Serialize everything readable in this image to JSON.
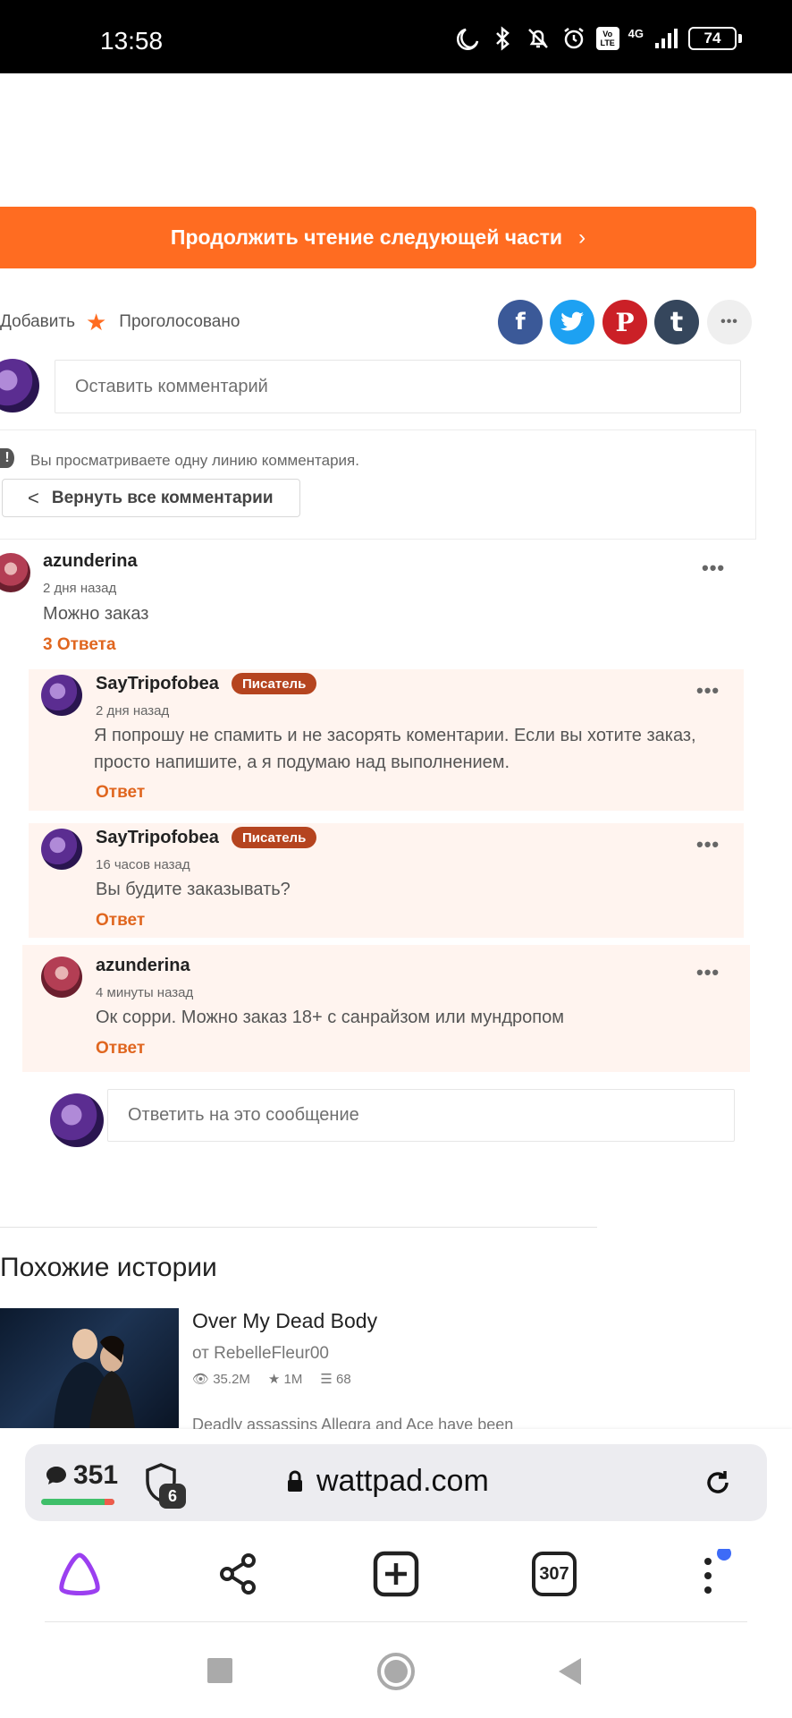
{
  "status_bar": {
    "time": "13:58",
    "network": "4G",
    "volte": "Vo LTE",
    "battery": "74"
  },
  "continue_button": {
    "label": "Продолжить чтение следующей части",
    "chevron": "›"
  },
  "vote": {
    "add_label": "Добавить",
    "voted_label": "Проголосовано"
  },
  "share": {
    "facebook": "f",
    "twitter": "twitter-icon",
    "pinterest": "P",
    "tumblr": "t",
    "more": "•••",
    "colors": {
      "facebook": "#3b5998",
      "twitter": "#1da1f2",
      "pinterest": "#cb2027",
      "tumblr": "#35465c",
      "more": "#efefef"
    }
  },
  "comment_input": {
    "placeholder": "Оставить комментарий"
  },
  "thread_notice": {
    "info": "!",
    "text": "Вы просматриваете одну линию комментария.",
    "back_label": "Вернуть все комментарии"
  },
  "main_comment": {
    "user": "azunderina",
    "time": "2 дня назад",
    "text": "Можно заказ",
    "replies_link": "3 Ответа",
    "more": "•••"
  },
  "replies": [
    {
      "user": "SayTripofobea",
      "badge": "Писатель",
      "time": "2 дня назад",
      "text": "Я попрошу не спамить и не засорять коментарии. Если вы хотите заказ, просто напишите, а я подумаю над выполнением.",
      "reply_link": "Ответ",
      "more": "•••"
    },
    {
      "user": "SayTripofobea",
      "badge": "Писатель",
      "time": "16 часов назад",
      "text": "Вы будите заказывать?",
      "reply_link": "Ответ",
      "more": "•••"
    },
    {
      "user": "azunderina",
      "time": "4 минуты назад",
      "text": "Ок сорри. Можно заказ 18+ с санрайзом или мундропом",
      "reply_link": "Ответ",
      "more": "•••"
    }
  ],
  "reply_input": {
    "placeholder": "Ответить на это сообщение"
  },
  "similar": {
    "title": "Похожие истории",
    "book": {
      "title": "Over My Dead Body",
      "author": "от RebelleFleur00",
      "reads": "35.2M",
      "votes": "1M",
      "parts": "68",
      "description": "Deadly assassins Allegra and Ace have been"
    }
  },
  "browser": {
    "chat_count": "351",
    "shield_count": "6",
    "url": "wattpad.com",
    "tabs_count": "307"
  }
}
